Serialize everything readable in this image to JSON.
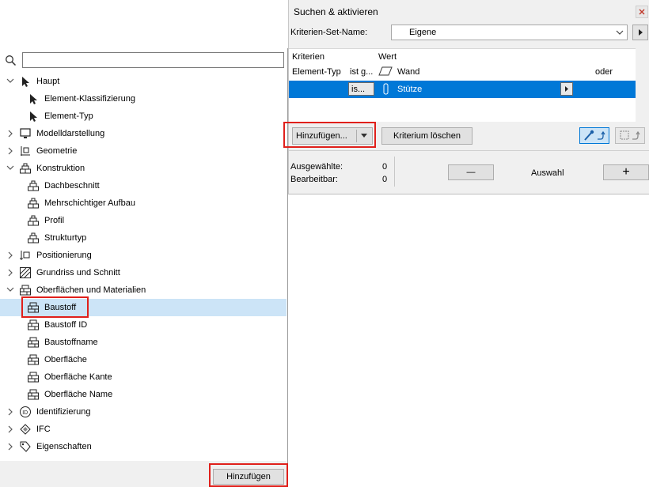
{
  "left_panel": {
    "search": {
      "value": "",
      "placeholder": ""
    },
    "tree": [
      {
        "label": "Haupt",
        "level": 0,
        "chevron": "down",
        "icon": "cursor-icon"
      },
      {
        "label": "Element-Klassifizierung",
        "level": 1,
        "chevron": "none",
        "icon": "cursor-icon"
      },
      {
        "label": "Element-Typ",
        "level": 1,
        "chevron": "none",
        "icon": "cursor-icon"
      },
      {
        "label": "Modelldarstellung",
        "level": 0,
        "chevron": "right",
        "icon": "monitor-icon"
      },
      {
        "label": "Geometrie",
        "level": 0,
        "chevron": "right",
        "icon": "geometry-icon"
      },
      {
        "label": "Konstruktion",
        "level": 0,
        "chevron": "down",
        "icon": "bricks-icon"
      },
      {
        "label": "Dachbeschnitt",
        "level": 1,
        "chevron": "none",
        "icon": "bricks-icon"
      },
      {
        "label": "Mehrschichtiger Aufbau",
        "level": 1,
        "chevron": "none",
        "icon": "bricks-icon"
      },
      {
        "label": "Profil",
        "level": 1,
        "chevron": "none",
        "icon": "bricks-icon"
      },
      {
        "label": "Strukturtyp",
        "level": 1,
        "chevron": "none",
        "icon": "bricks-icon"
      },
      {
        "label": "Positionierung",
        "level": 0,
        "chevron": "right",
        "icon": "positioning-icon"
      },
      {
        "label": "Grundriss und Schnitt",
        "level": 0,
        "chevron": "right",
        "icon": "hatch-icon"
      },
      {
        "label": "Oberflächen und Materialien",
        "level": 0,
        "chevron": "down",
        "icon": "material-icon"
      },
      {
        "label": "Baustoff",
        "level": 1,
        "chevron": "none",
        "icon": "material-icon",
        "selected": true
      },
      {
        "label": "Baustoff ID",
        "level": 1,
        "chevron": "none",
        "icon": "material-icon"
      },
      {
        "label": "Baustoffname",
        "level": 1,
        "chevron": "none",
        "icon": "material-icon"
      },
      {
        "label": "Oberfläche",
        "level": 1,
        "chevron": "none",
        "icon": "material-icon"
      },
      {
        "label": "Oberfläche Kante",
        "level": 1,
        "chevron": "none",
        "icon": "material-icon"
      },
      {
        "label": "Oberfläche Name",
        "level": 1,
        "chevron": "none",
        "icon": "material-icon"
      },
      {
        "label": "Identifizierung",
        "level": 0,
        "chevron": "right",
        "icon": "id-icon"
      },
      {
        "label": "IFC",
        "level": 0,
        "chevron": "right",
        "icon": "ifc-icon"
      },
      {
        "label": "Eigenschaften",
        "level": 0,
        "chevron": "right",
        "icon": "tag-icon"
      }
    ],
    "add_button": "Hinzufügen"
  },
  "dialog": {
    "title": "Suchen & aktivieren",
    "set_label": "Kriterien-Set-Name:",
    "set_value": "Eigene",
    "columns": {
      "criteria": "Kriterien",
      "value": "Wert"
    },
    "row1": {
      "criteria": "Element-Typ",
      "operator": "ist g...",
      "value": "Wand",
      "logic": "oder"
    },
    "row2": {
      "operator": "is...",
      "value": "Stütze"
    },
    "add_label": "Hinzufügen...",
    "delete_label": "Kriterium löschen",
    "selected_label": "Ausgewählte:",
    "selected_count": "0",
    "editable_label": "Bearbeitbar:",
    "editable_count": "0",
    "minus": "—",
    "selection_label": "Auswahl",
    "plus": "+"
  },
  "colors": {
    "selection": "#0078d7",
    "tree_selection": "#cce4f7",
    "highlight": "#e0201b"
  }
}
